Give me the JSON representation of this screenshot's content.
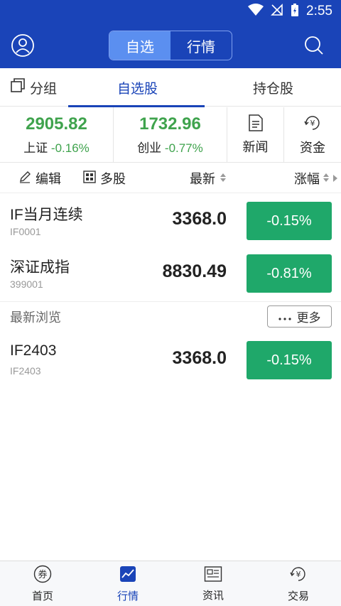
{
  "status_bar": {
    "time": "2:55"
  },
  "header": {
    "segments": [
      {
        "label": "自选",
        "active": true
      },
      {
        "label": "行情",
        "active": false
      }
    ]
  },
  "sub_tabs": [
    {
      "label": "分组",
      "active": false
    },
    {
      "label": "自选股",
      "active": true
    },
    {
      "label": "持仓股",
      "active": false
    }
  ],
  "indices": [
    {
      "value": "2905.82",
      "name": "上证",
      "change": "-0.16%"
    },
    {
      "value": "1732.96",
      "name": "创业",
      "change": "-0.77%"
    }
  ],
  "actions": [
    {
      "label": "新闻",
      "icon": "news-icon"
    },
    {
      "label": "资金",
      "icon": "fund-icon"
    }
  ],
  "toolbar": {
    "edit_label": "编辑",
    "multi_label": "多股",
    "latest_label": "最新",
    "change_label": "涨幅"
  },
  "watchlist": [
    {
      "name": "IF当月连续",
      "code": "IF0001",
      "price": "3368.0",
      "change": "-0.15%"
    },
    {
      "name": "深证成指",
      "code": "399001",
      "price": "8830.49",
      "change": "-0.81%"
    }
  ],
  "recent": {
    "title": "最新浏览",
    "more_label": "更多",
    "items": [
      {
        "name": "IF2403",
        "code": "IF2403",
        "price": "3368.0",
        "change": "-0.15%"
      }
    ]
  },
  "bottom_nav": [
    {
      "label": "首页",
      "icon": "home-coupon-icon",
      "active": false
    },
    {
      "label": "行情",
      "icon": "market-chart-icon",
      "active": true
    },
    {
      "label": "资讯",
      "icon": "info-icon",
      "active": false
    },
    {
      "label": "交易",
      "icon": "trade-icon",
      "active": false
    }
  ],
  "colors": {
    "brand_blue": "#1a44b8",
    "segment_active": "#5b8ff0",
    "down_green": "#3fa34d",
    "badge_green": "#1fa86a"
  }
}
